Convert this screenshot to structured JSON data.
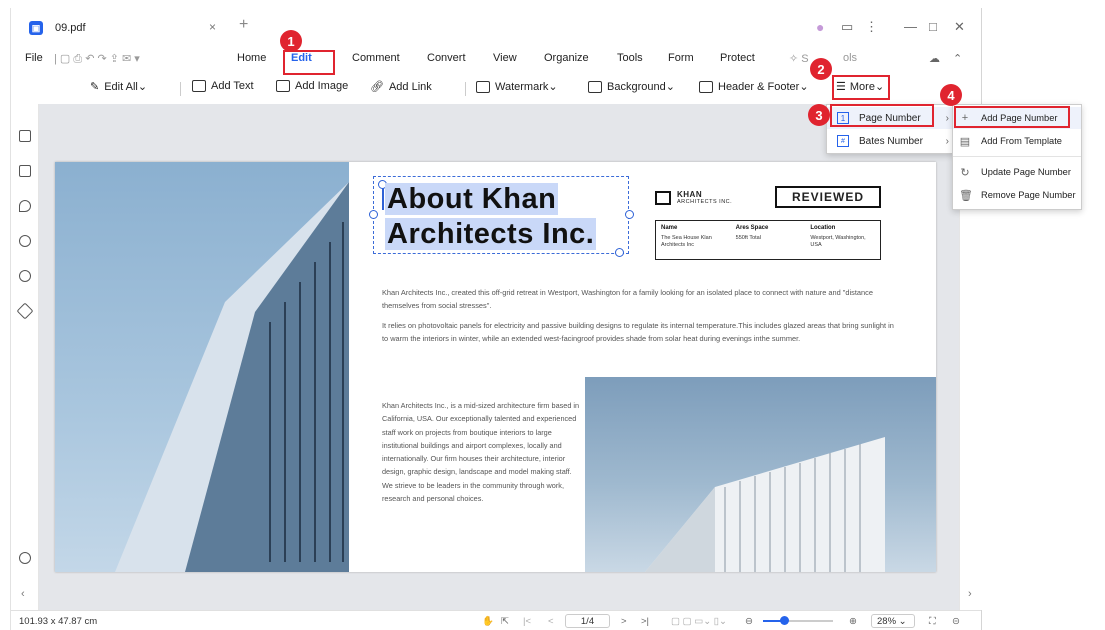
{
  "window": {
    "tab_title": "09.pdf"
  },
  "menu": {
    "file": "File",
    "items": [
      "Home",
      "Edit",
      "Comment",
      "Convert",
      "View",
      "Organize",
      "Tools",
      "Form",
      "Protect"
    ],
    "search_partial_left": "S",
    "search_partial_right": "ols"
  },
  "toolbar": {
    "edit_all": "Edit All",
    "add_text": "Add Text",
    "add_image": "Add Image",
    "add_link": "Add Link",
    "watermark": "Watermark",
    "background": "Background",
    "header_footer": "Header & Footer",
    "more": "More"
  },
  "dropdown": {
    "page_number": "Page Number",
    "bates_number": "Bates Number"
  },
  "submenu": {
    "add_page_number": "Add Page Number",
    "add_from_template": "Add From Template",
    "update_page_number": "Update Page Number",
    "remove_page_number": "Remove Page Number"
  },
  "document": {
    "headline_line1": "About Khan",
    "headline_line2": "Architects Inc.",
    "khan_brand": "KHAN",
    "khan_sub": "ARCHITECTS INC.",
    "reviewed": "REVIEWED",
    "table": [
      {
        "head": "Name",
        "value": "The Sea House Klan Architects Inc"
      },
      {
        "head": "Ares Space",
        "value": "550ft Total"
      },
      {
        "head": "Location",
        "value": "Westport, Washington, USA"
      }
    ],
    "para1": "Khan Architects Inc., created this off-grid retreat in Westport, Washington for a family looking for an isolated place to connect with nature and \"distance themselves from social stresses\".",
    "para2": "It relies on photovoltaic panels for electricity and passive building designs to regulate its internal temperature.This includes glazed areas that bring sunlight in to warm the interiors in winter, while an extended west-facingroof provides shade from solar heat during evenings inthe summer.",
    "para3": "Khan Architects Inc., is a mid-sized architecture firm based in California, USA. Our exceptionally talented and experienced staff work on projects from boutique interiors to large institutional buildings and airport complexes, locally and internationally. Our firm houses their architecture, interior design, graphic design, landscape and model making staff. We strieve to be leaders in the community through work, research and personal choices."
  },
  "status": {
    "dimensions": "101.93 x 47.87 cm",
    "page": "1/4",
    "zoom": "28%"
  },
  "markers": [
    "1",
    "2",
    "3",
    "4"
  ],
  "colors": {
    "accent": "#2563eb",
    "highlight": "#e0242f"
  }
}
